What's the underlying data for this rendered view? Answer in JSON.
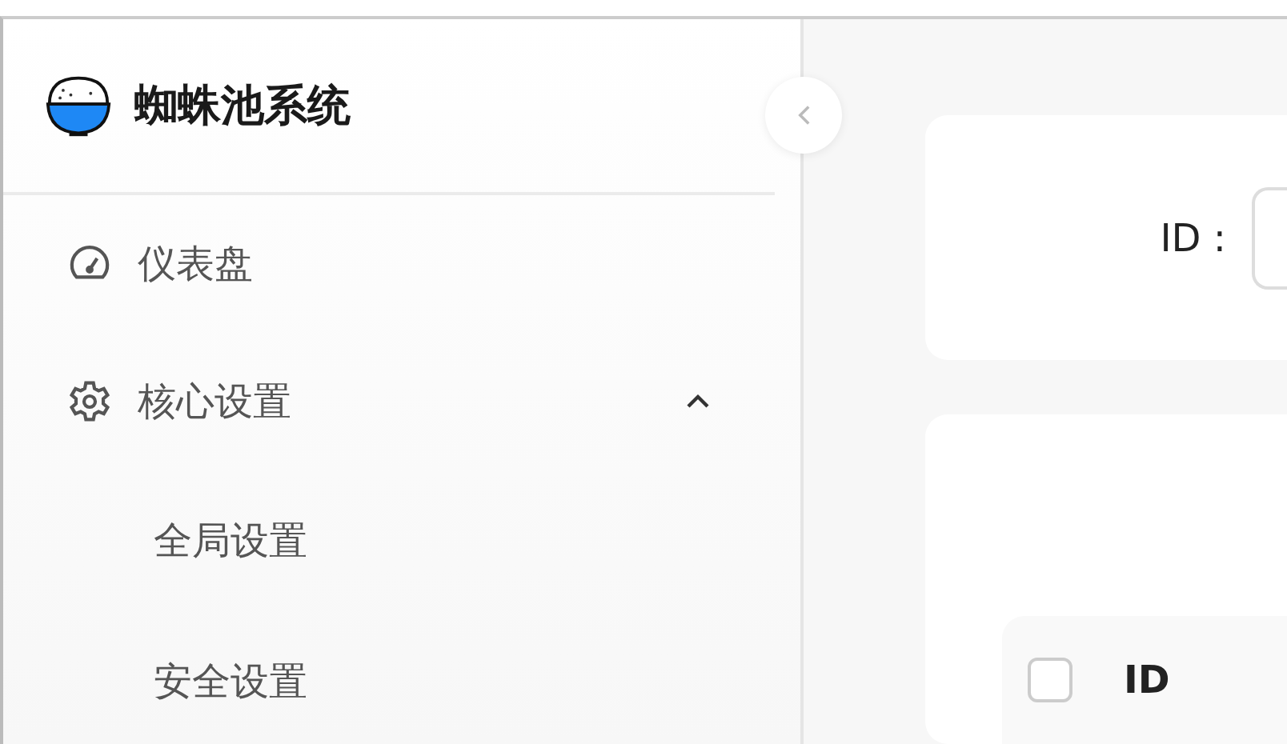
{
  "brand": {
    "title": "蜘蛛池系统"
  },
  "sidebar": {
    "items": [
      {
        "label": "仪表盘",
        "kind": "dashboard"
      },
      {
        "label": "核心设置",
        "kind": "settings",
        "expanded": true,
        "children": [
          {
            "label": "全局设置"
          },
          {
            "label": "安全设置"
          }
        ]
      }
    ]
  },
  "search": {
    "label": "ID :"
  },
  "table": {
    "select_all": {
      "checked": false
    },
    "columns": [
      "ID"
    ]
  }
}
